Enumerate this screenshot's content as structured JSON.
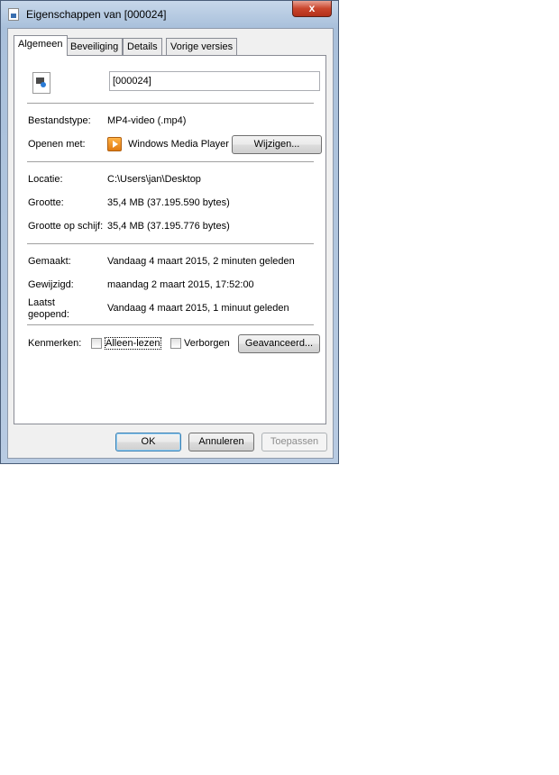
{
  "window": {
    "title": "Eigenschappen van [000024]",
    "close_glyph": "x"
  },
  "tabs": [
    {
      "label": "Algemeen",
      "active": true
    },
    {
      "label": "Beveiliging",
      "active": false
    },
    {
      "label": "Details",
      "active": false
    },
    {
      "label": "Vorige versies",
      "active": false
    }
  ],
  "general": {
    "file_name": "[000024]",
    "file_type_label": "Bestandstype:",
    "file_type_value": "MP4-video (.mp4)",
    "open_with_label": "Openen met:",
    "open_with_value": "Windows Media Player",
    "change_button": "Wijzigen...",
    "location_label": "Locatie:",
    "location_value": "C:\\Users\\jan\\Desktop",
    "size_label": "Grootte:",
    "size_value": "35,4 MB (37.195.590 bytes)",
    "size_on_disk_label": "Grootte op schijf:",
    "size_on_disk_value": "35,4 MB (37.195.776 bytes)",
    "created_label": "Gemaakt:",
    "created_value": "Vandaag 4 maart 2015, 2 minuten geleden",
    "modified_label": "Gewijzigd:",
    "modified_value": "maandag 2 maart 2015, 17:52:00",
    "accessed_label_line1": "Laatst",
    "accessed_label_line2": "geopend:",
    "accessed_value": "Vandaag 4 maart 2015, 1 minuut geleden",
    "attributes_label": "Kenmerken:",
    "readonly_label": "Alleen-lezen",
    "readonly_checked": false,
    "hidden_label": "Verborgen",
    "hidden_checked": false,
    "advanced_button": "Geavanceerd..."
  },
  "footer": {
    "ok": "OK",
    "cancel": "Annuleren",
    "apply": "Toepassen"
  },
  "colors": {
    "title_glass": "#b8cbe2",
    "close_button": "#c9452c",
    "default_button_border": "#3c7fb1"
  },
  "icons": {
    "title": "file-properties-icon",
    "file": "video-file-icon",
    "open_with": "windows-media-player-icon"
  }
}
